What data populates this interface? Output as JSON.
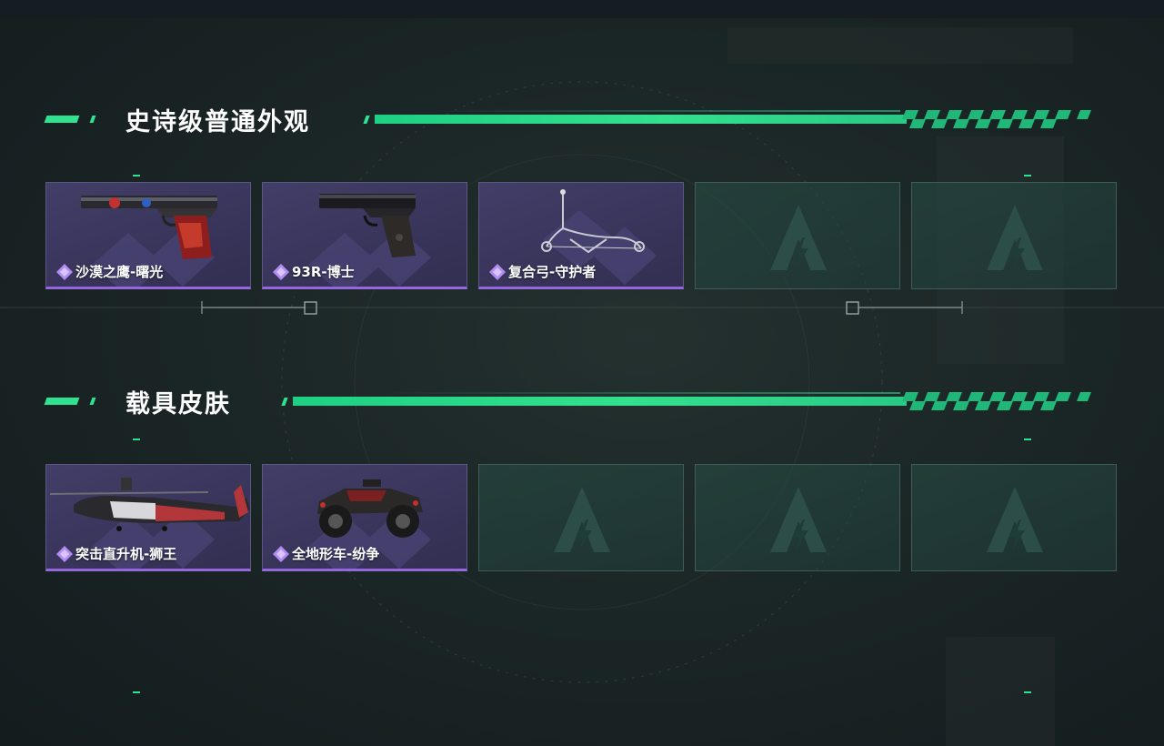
{
  "sections": [
    {
      "title": "史诗级普通外观",
      "items": [
        {
          "name": "沙漠之鹰-曙光",
          "icon": "pistol-deagle-icon"
        },
        {
          "name": "93R-博士",
          "icon": "pistol-93r-icon"
        },
        {
          "name": "复合弓-守护者",
          "icon": "compound-bow-icon"
        },
        {
          "name": "",
          "icon": "empty-slot-logo-icon"
        },
        {
          "name": "",
          "icon": "empty-slot-logo-icon"
        }
      ]
    },
    {
      "title": "载具皮肤",
      "items": [
        {
          "name": "突击直升机-狮王",
          "icon": "attack-helicopter-icon"
        },
        {
          "name": "全地形车-纷争",
          "icon": "atv-quad-icon"
        },
        {
          "name": "",
          "icon": "empty-slot-logo-icon"
        },
        {
          "name": "",
          "icon": "empty-slot-logo-icon"
        },
        {
          "name": "",
          "icon": "empty-slot-logo-icon"
        }
      ]
    }
  ],
  "colors": {
    "accent": "#2ee28f",
    "card_fill": "#3a355c",
    "rarity_purple": "#9567df",
    "empty_slot": "#284e48"
  }
}
